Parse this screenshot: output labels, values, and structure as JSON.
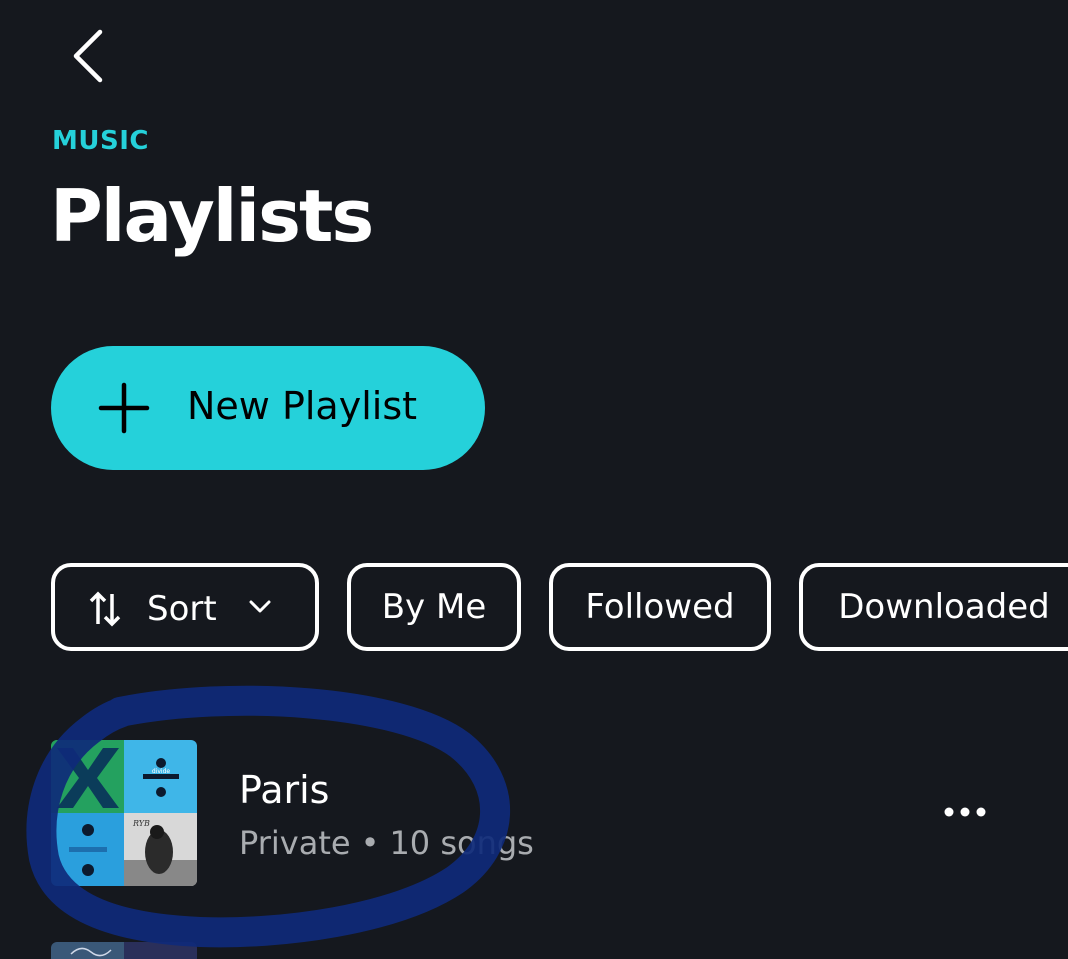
{
  "header": {
    "eyebrow": "MUSIC",
    "title": "Playlists"
  },
  "actions": {
    "new_playlist_label": "New Playlist"
  },
  "filters": {
    "sort_label": "Sort",
    "chips": [
      "By Me",
      "Followed",
      "Downloaded"
    ]
  },
  "playlists": [
    {
      "title": "Paris",
      "visibility": "Private",
      "separator": "•",
      "song_count": "10 songs",
      "artwork_text": [
        "divide",
        "RYB"
      ]
    }
  ],
  "colors": {
    "background": "#15181e",
    "accent": "#25d1da",
    "annotation": "#0f2a7a",
    "subtext": "#a9acb0"
  },
  "icons": [
    "back-chevron-icon",
    "plus-icon",
    "sort-arrows-icon",
    "chevron-down-icon",
    "more-dots-icon"
  ]
}
